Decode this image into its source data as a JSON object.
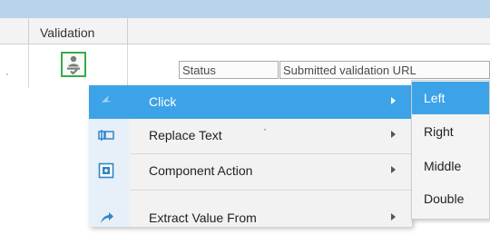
{
  "grid": {
    "header": {
      "validation_label": "Validation"
    },
    "row": {
      "status_field": "Status",
      "submitted_field": "Submitted  validation URL"
    }
  },
  "context_menu": {
    "items": [
      {
        "label": "Click",
        "icon": "pointer-icon",
        "has_submenu": true,
        "highlighted": true
      },
      {
        "label": "Replace Text",
        "icon": "replace-text-icon",
        "has_submenu": true
      },
      {
        "label": "Component Action",
        "icon": "component-icon",
        "has_submenu": true
      },
      {
        "label": "Extract Value From",
        "icon": "extract-arrow-icon",
        "has_submenu": true
      }
    ]
  },
  "submenu": {
    "items": [
      {
        "label": "Left",
        "highlighted": true
      },
      {
        "label": "Right"
      },
      {
        "label": "Middle"
      },
      {
        "label": "Double"
      }
    ]
  },
  "colors": {
    "highlight": "#3da3e8",
    "top_strip": "#b9d3ea",
    "validation_border": "#39a94a"
  }
}
